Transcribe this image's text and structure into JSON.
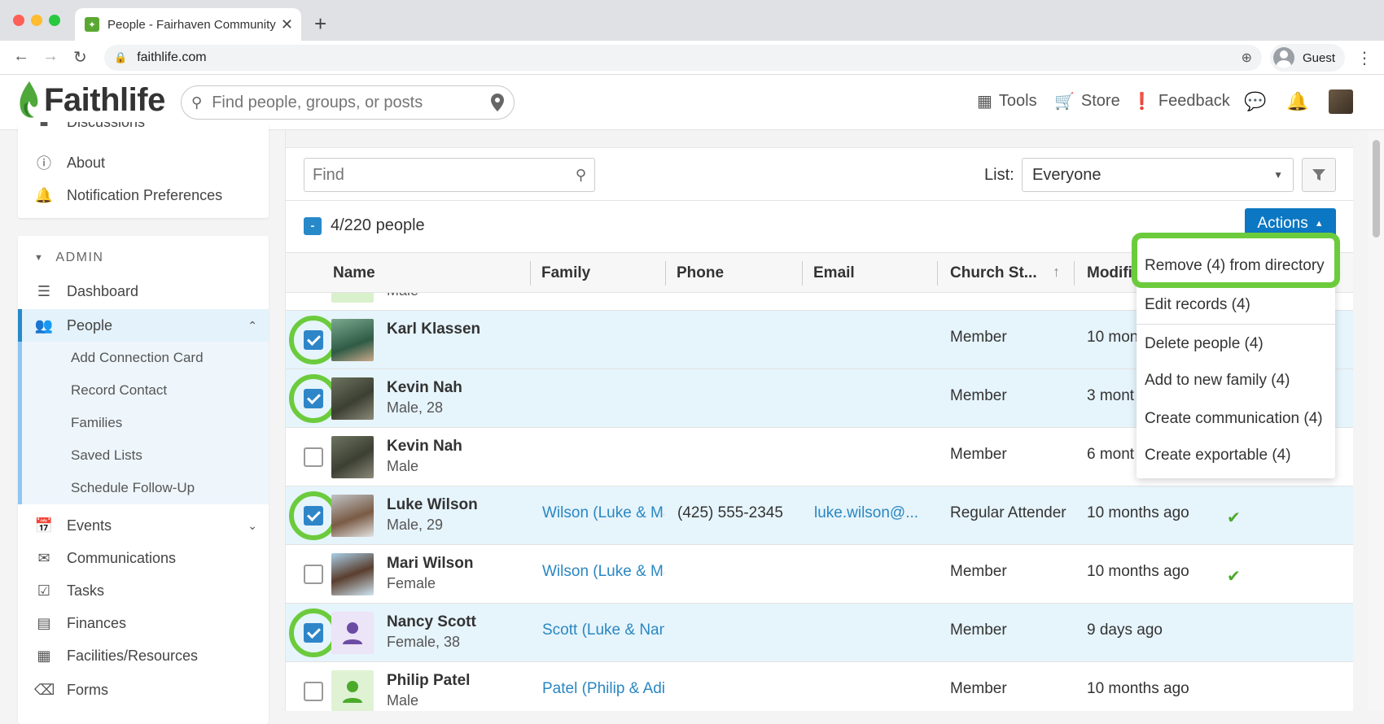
{
  "browser": {
    "tab_title": "People - Fairhaven Community",
    "url": "faithlife.com",
    "profile_label": "Guest"
  },
  "header": {
    "brand": "Faithlife",
    "search_placeholder": "Find people, groups, or posts",
    "tools_label": "Tools",
    "store_label": "Store",
    "feedback_label": "Feedback"
  },
  "sidebar": {
    "top_items": [
      {
        "label": "Discussions",
        "icon": "chat-icon"
      },
      {
        "label": "About",
        "icon": "info-icon"
      },
      {
        "label": "Notification Preferences",
        "icon": "bell-icon"
      }
    ],
    "admin_header": "ADMIN",
    "admin_items": [
      {
        "label": "Dashboard",
        "icon": "dashboard-icon"
      },
      {
        "label": "People",
        "icon": "people-icon",
        "active": true
      }
    ],
    "people_subitems": [
      "Add Connection Card",
      "Record Contact",
      "Families",
      "Saved Lists",
      "Schedule Follow-Up"
    ],
    "more_items": [
      {
        "label": "Events",
        "icon": "calendar-icon"
      },
      {
        "label": "Communications",
        "icon": "envelope-icon"
      },
      {
        "label": "Tasks",
        "icon": "clipboard-icon"
      },
      {
        "label": "Finances",
        "icon": "card-icon"
      },
      {
        "label": "Facilities/Resources",
        "icon": "building-icon"
      },
      {
        "label": "Forms",
        "icon": "form-icon"
      }
    ]
  },
  "toolbar": {
    "find_placeholder": "Find",
    "list_label": "List:",
    "list_value": "Everyone",
    "selection_count": "4/220 people",
    "selection_box": "-",
    "actions_label": "Actions"
  },
  "table": {
    "columns": [
      "Name",
      "Family",
      "Phone",
      "Email",
      "Church St...",
      "Modifi"
    ],
    "partial_row_sub": "Male",
    "rows": [
      {
        "name": "Karl Klassen",
        "sub": "",
        "family": "",
        "phone": "",
        "email": "",
        "status": "Member",
        "modified": "10 mon",
        "checked": true,
        "attendance_check": false
      },
      {
        "name": "Kevin Nah",
        "sub": "Male, 28",
        "family": "",
        "phone": "",
        "email": "",
        "status": "Member",
        "modified": "3 mont",
        "checked": true,
        "attendance_check": false
      },
      {
        "name": "Kevin Nah",
        "sub": "Male",
        "family": "",
        "phone": "",
        "email": "",
        "status": "Member",
        "modified": "6 mont",
        "checked": false,
        "attendance_check": false
      },
      {
        "name": "Luke Wilson",
        "sub": "Male, 29",
        "family": "Wilson (Luke & Ma",
        "phone": "(425) 555-2345",
        "email": "luke.wilson@...",
        "status": "Regular Attender",
        "modified": "10 months ago",
        "checked": true,
        "attendance_check": true
      },
      {
        "name": "Mari Wilson",
        "sub": "Female",
        "family": "Wilson (Luke & Ma",
        "phone": "",
        "email": "",
        "status": "Member",
        "modified": "10 months ago",
        "checked": false,
        "attendance_check": true
      },
      {
        "name": "Nancy Scott",
        "sub": "Female, 38",
        "family": "Scott (Luke & Nan",
        "phone": "",
        "email": "",
        "status": "Member",
        "modified": "9 days ago",
        "checked": true,
        "attendance_check": false
      },
      {
        "name": "Philip Patel",
        "sub": "Male",
        "family": "Patel (Philip & Adi",
        "phone": "",
        "email": "",
        "status": "Member",
        "modified": "10 months ago",
        "checked": false,
        "attendance_check": false
      }
    ]
  },
  "actions_menu": {
    "items": [
      "Remove (4) from directory",
      "Edit records (4)",
      "Delete people (4)",
      "Add to new family (4)",
      "Create communication (4)",
      "Create exportable (4)"
    ]
  },
  "colors": {
    "accent": "#0c77c2",
    "highlight_ring": "#6ccb3c",
    "link": "#2a87c1",
    "brand_green": "#5aa832"
  }
}
